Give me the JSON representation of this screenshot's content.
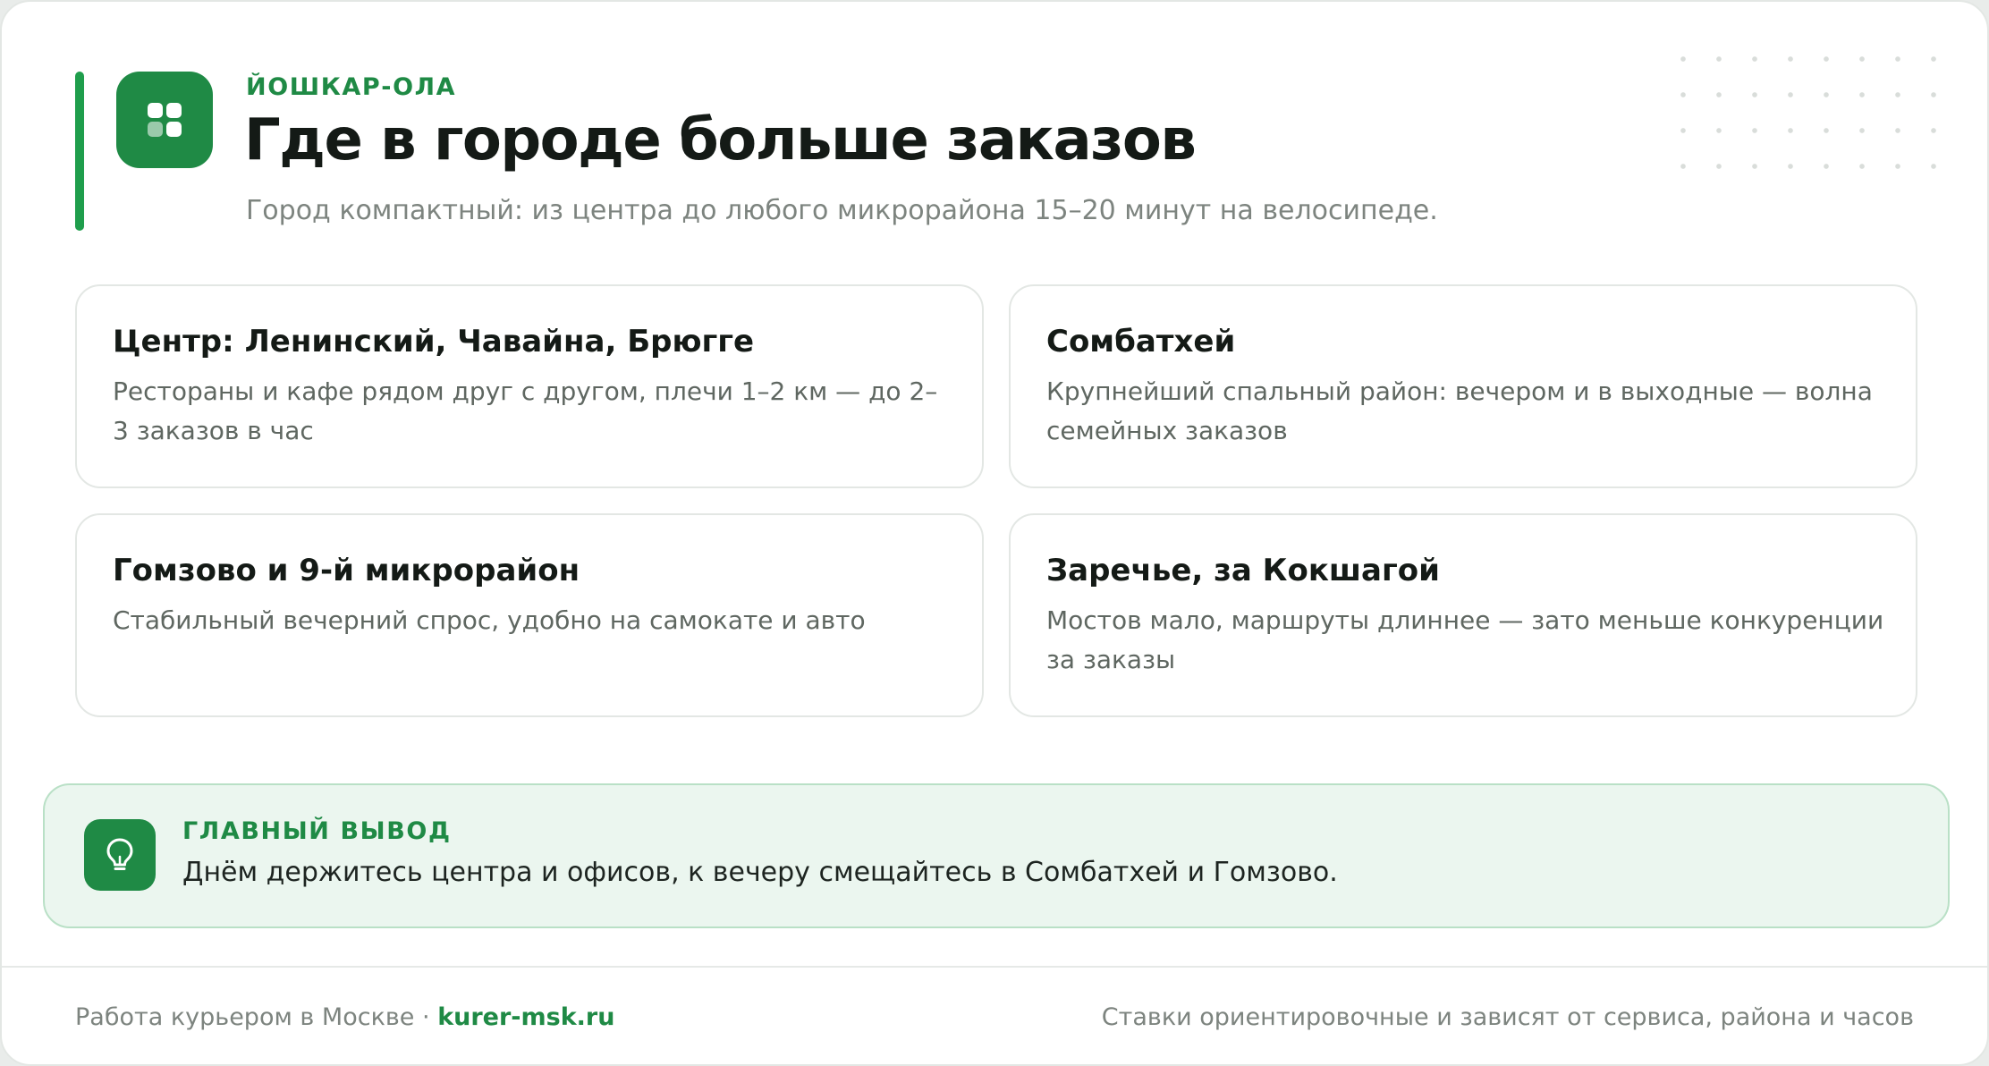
{
  "colors": {
    "accent": "#1f8a45",
    "accent_bar": "#1f9e4c",
    "takeaway_bg": "#ebf6ef",
    "takeaway_border": "#b9e0c6",
    "text_primary": "#141a16",
    "text_muted": "#7d847f"
  },
  "header": {
    "icon": "grid-icon",
    "eyebrow": "ЙОШКАР-ОЛА",
    "title": "Где в городе больше заказов",
    "subtitle": "Город компактный: из центра до любого микрорайона 15–20 минут на велосипеде."
  },
  "districts": [
    {
      "name": "Центр: Ленинский, Чавайна, Брюгге",
      "description": "Рестораны и кафе рядом друг с другом, плечи 1–2 км — до 2–3 заказов в час"
    },
    {
      "name": "Сомбатхей",
      "description": "Крупнейший спальный район: вечером и в выходные — волна семейных заказов"
    },
    {
      "name": "Гомзово и 9-й микрорайон",
      "description": "Стабильный вечерний спрос, удобно на самокате и авто"
    },
    {
      "name": "Заречье, за Кокшагой",
      "description": "Мостов мало, маршруты длиннее — зато меньше конкуренции за заказы"
    }
  ],
  "takeaway": {
    "icon": "lightbulb-icon",
    "label": "ГЛАВНЫЙ ВЫВОД",
    "text": "Днём держитесь центра и офисов, к вечеру смещайтесь в Сомбатхей и Гомзово."
  },
  "footer": {
    "site_text": "Работа курьером в Москве",
    "separator": "·",
    "link": "kurer-msk.ru",
    "disclaimer": "Ставки ориентировочные и зависят от сервиса, района и часов"
  }
}
